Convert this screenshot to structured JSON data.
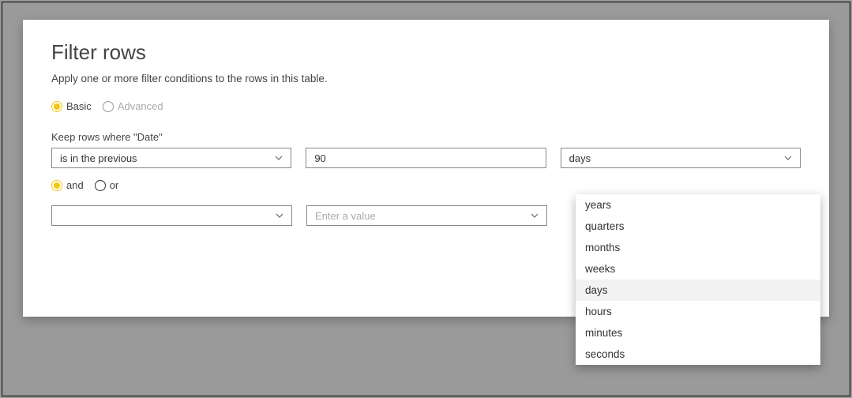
{
  "dialog": {
    "title": "Filter rows",
    "subtitle": "Apply one or more filter conditions to the rows in this table."
  },
  "mode": {
    "basic_label": "Basic",
    "advanced_label": "Advanced",
    "selected": "Basic"
  },
  "keep_label": "Keep rows where \"Date\"",
  "row1": {
    "condition_selected": "is in the previous",
    "value": "90",
    "unit_selected": "days"
  },
  "logic": {
    "and_label": "and",
    "or_label": "or",
    "selected": "and"
  },
  "row2": {
    "condition_selected": "",
    "value_placeholder": "Enter a value",
    "unit_selected": ""
  },
  "unit_options": [
    "years",
    "quarters",
    "months",
    "weeks",
    "days",
    "hours",
    "minutes",
    "seconds"
  ],
  "unit_highlighted": "days"
}
